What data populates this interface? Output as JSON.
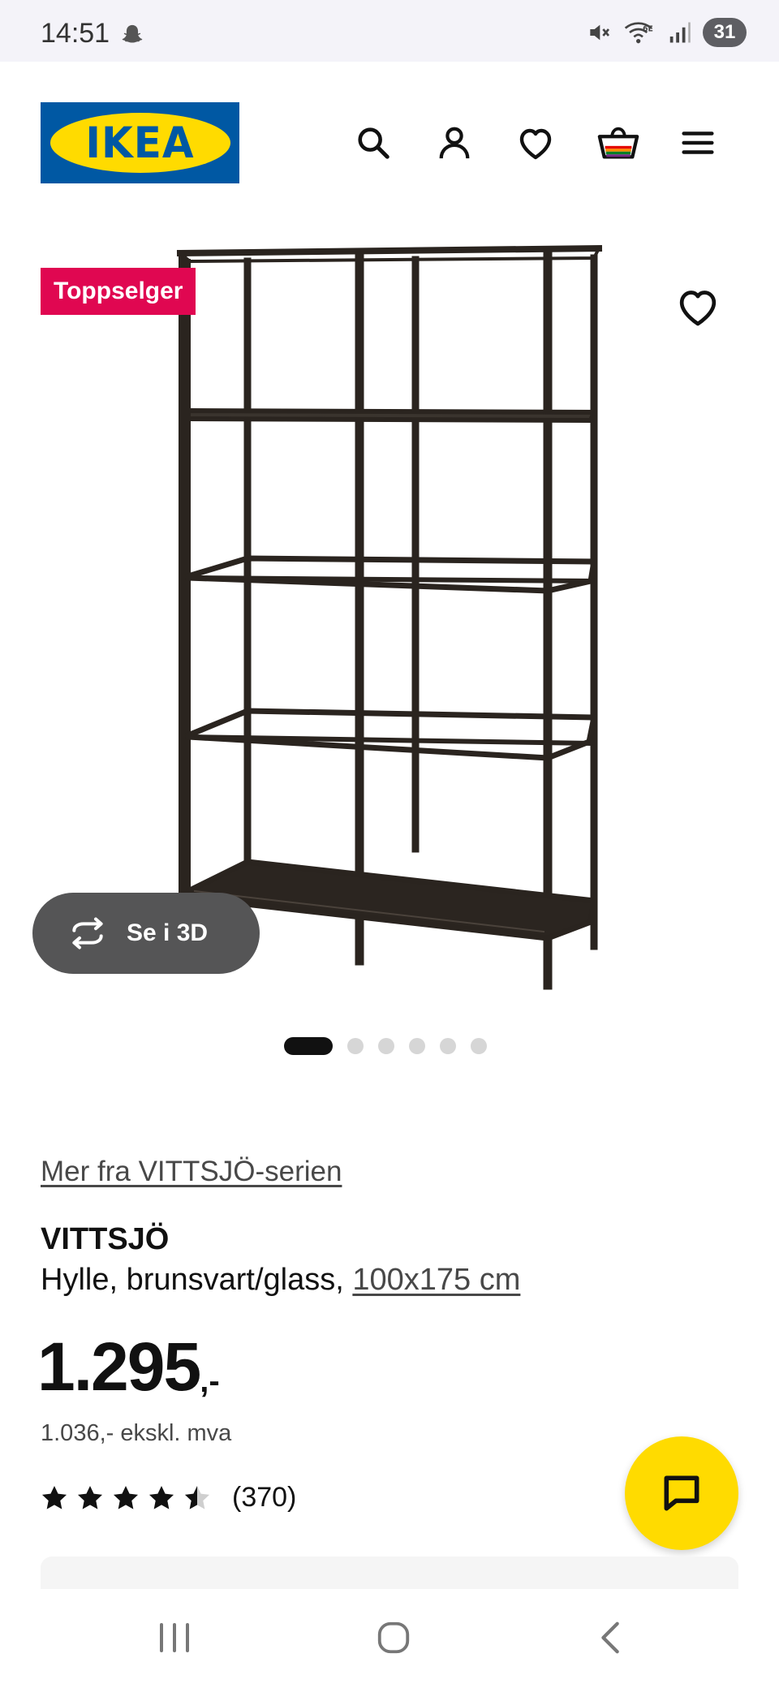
{
  "status_bar": {
    "time": "14:51",
    "battery": "31",
    "icons": [
      "snapchat-ghost-icon",
      "mute-icon",
      "wifi-6e-icon",
      "signal-icon"
    ]
  },
  "header": {
    "logo_text": "IKEA",
    "icons": [
      "search-icon",
      "user-icon",
      "heart-icon",
      "shopping-bag-icon",
      "menu-icon"
    ]
  },
  "product_image": {
    "badge": "Toppselger",
    "view_3d_label": "Se i 3D",
    "carousel": {
      "count": 6,
      "active_index": 0
    }
  },
  "product": {
    "series_link": "Mer fra VITTSJÖ-serien",
    "name": "VITTSJÖ",
    "description": "Hylle, brunsvart/glass, ",
    "dimensions": "100x175 cm",
    "price_main": "1.295",
    "price_suffix": ",-",
    "price_excl_vat": "1.036,- ekskl. mva",
    "rating_value": 4.5,
    "rating_max": 5,
    "rating_count": "(370)"
  },
  "colors": {
    "ikea_blue": "#0058a3",
    "ikea_yellow": "#ffdb00",
    "badge_red": "#e00751",
    "shelf_frame": "#2a241f"
  }
}
